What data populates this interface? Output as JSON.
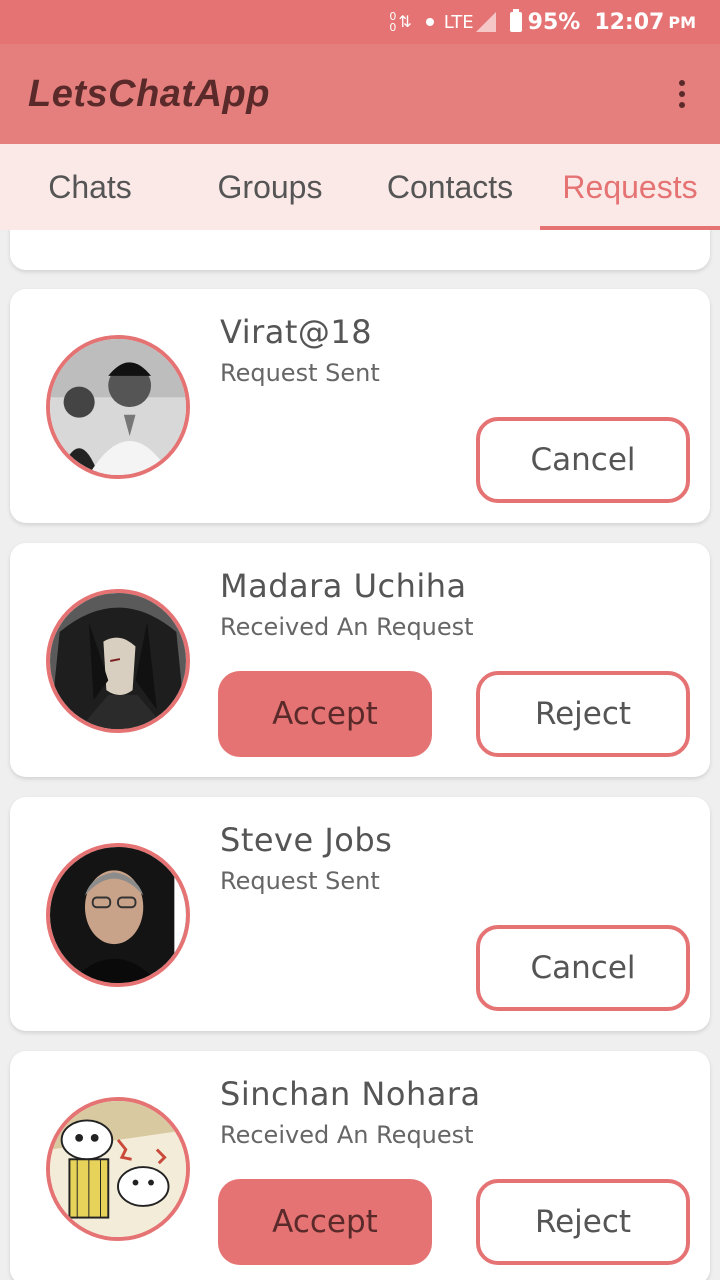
{
  "status_bar": {
    "data_up": "0",
    "data_down": "0",
    "network": "LTE",
    "battery": "95%",
    "time": "12:07",
    "ampm": "PM"
  },
  "app_bar": {
    "title": "LetsChatApp",
    "menu_icon": "overflow-menu-icon"
  },
  "tabs": [
    {
      "label": "Chats",
      "active": false
    },
    {
      "label": "Groups",
      "active": false
    },
    {
      "label": "Contacts",
      "active": false
    },
    {
      "label": "Requests",
      "active": true
    }
  ],
  "colors": {
    "accent": "#e57373",
    "app_bar": "#e57f7d",
    "tab_bar": "#fbe9e8",
    "title_text": "#5a2a2a"
  },
  "requests": [
    {
      "name": "Virat@18",
      "status": "Request Sent",
      "avatar": "person-avatar-icon",
      "actions": {
        "cancel": "Cancel"
      }
    },
    {
      "name": "Madara Uchiha",
      "status": "Received An Request",
      "avatar": "anime-avatar-icon",
      "actions": {
        "accept": "Accept",
        "reject": "Reject"
      }
    },
    {
      "name": "Steve Jobs",
      "status": "Request Sent",
      "avatar": "person-avatar-icon",
      "actions": {
        "cancel": "Cancel"
      }
    },
    {
      "name": "Sinchan Nohara",
      "status": "Received An Request",
      "avatar": "cartoon-avatar-icon",
      "actions": {
        "accept": "Accept",
        "reject": "Reject"
      }
    }
  ]
}
